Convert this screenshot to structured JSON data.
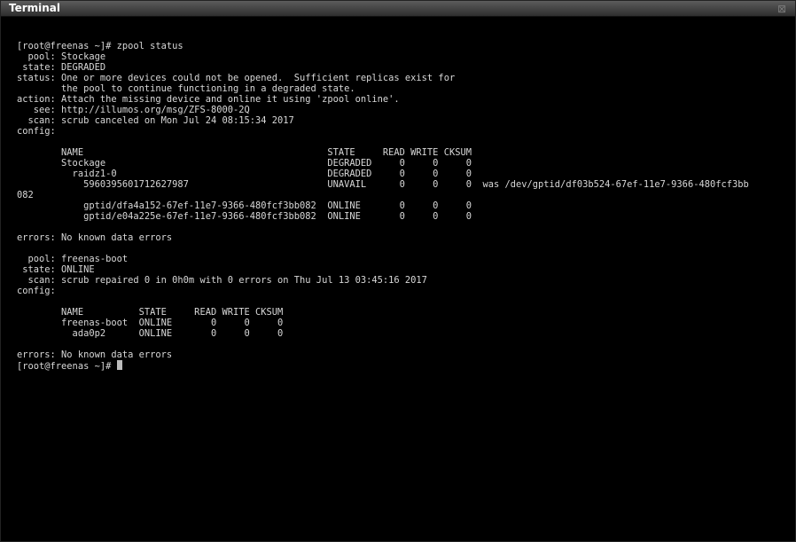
{
  "window": {
    "title": "Terminal",
    "close_glyph": "⊠"
  },
  "terminal": {
    "lines": [
      "[root@freenas ~]# zpool status",
      "  pool: Stockage",
      " state: DEGRADED",
      "status: One or more devices could not be opened.  Sufficient replicas exist for",
      "        the pool to continue functioning in a degraded state.",
      "action: Attach the missing device and online it using 'zpool online'.",
      "   see: http://illumos.org/msg/ZFS-8000-2Q",
      "  scan: scrub canceled on Mon Jul 24 08:15:34 2017",
      "config:",
      "",
      "        NAME                                            STATE     READ WRITE CKSUM",
      "        Stockage                                        DEGRADED     0     0     0",
      "          raidz1-0                                      DEGRADED     0     0     0",
      "            596039560171262​7987                         UNAVAIL      0     0     0  was /dev/gptid/df03b524-67ef-11e7-9366-480fcf3bb",
      "082",
      "            gptid/dfa4a152-67ef-11e7-9366-480fcf3bb082  ONLINE       0     0     0",
      "            gptid/e04a225e-67ef-11e7-9366-480fcf3bb082  ONLINE       0     0     0",
      "",
      "errors: No known data errors",
      "",
      "  pool: freenas-boot",
      " state: ONLINE",
      "  scan: scrub repaired 0 in 0h0m with 0 errors on Thu Jul 13 03:45:16 2017",
      "config:",
      "",
      "        NAME          STATE     READ WRITE CKSUM",
      "        freenas-boot  ONLINE       0     0     0",
      "          ada0p2      ONLINE       0     0     0",
      "",
      "errors: No known data errors"
    ],
    "prompt": "[root@freenas ~]# "
  }
}
